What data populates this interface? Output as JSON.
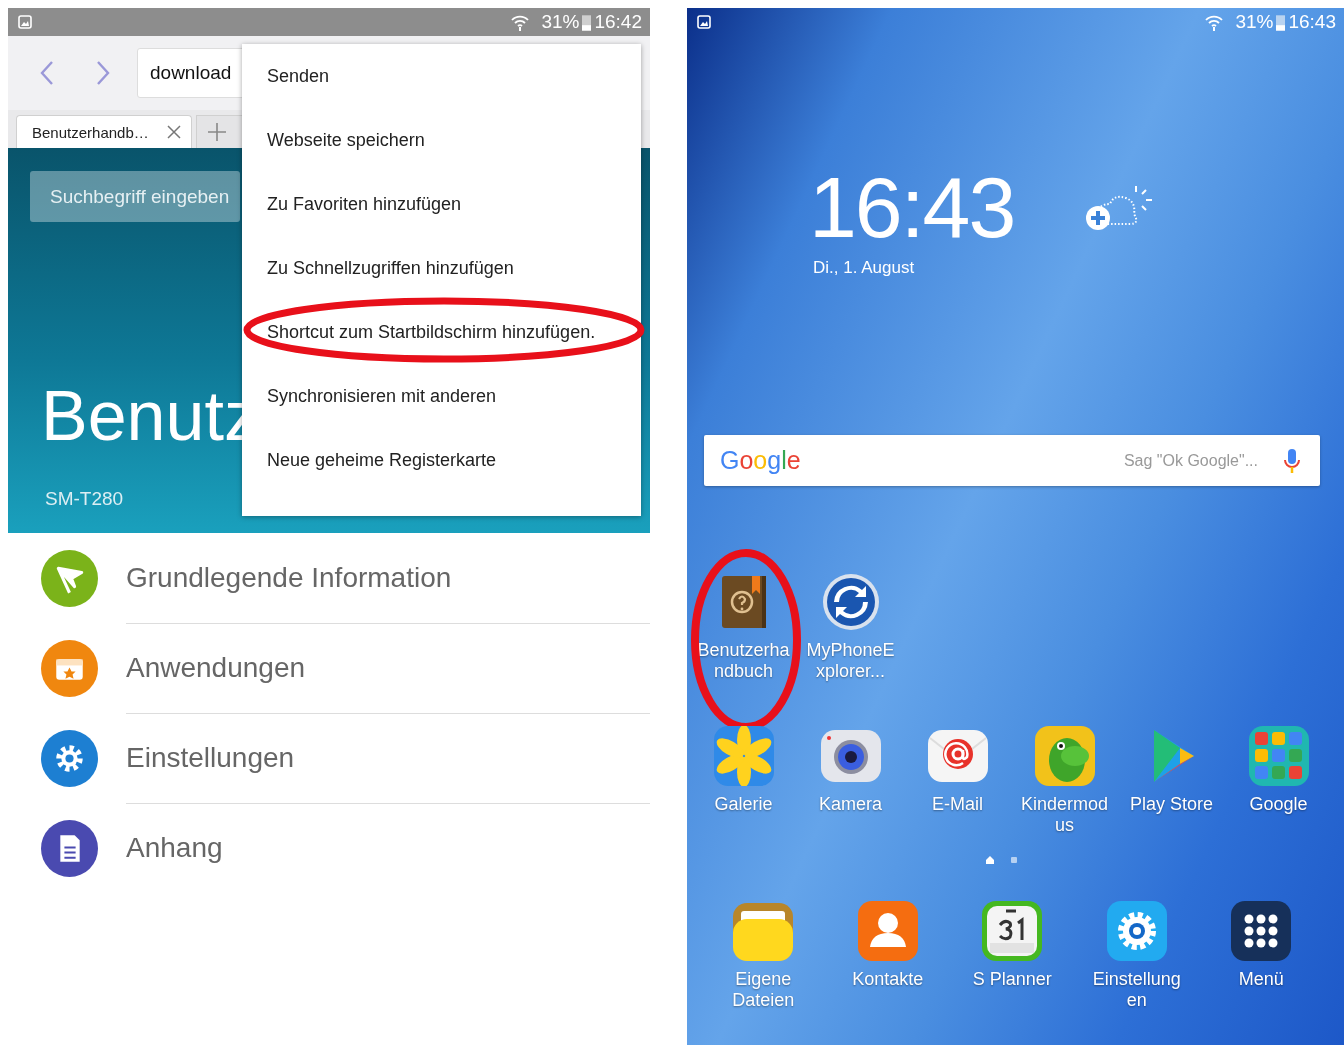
{
  "browser": {
    "status_bar": {
      "battery": "31%",
      "time": "16:42"
    },
    "url": "download",
    "tabs": [
      {
        "label": "Benutzerhandb…",
        "selected": true
      }
    ],
    "header": {
      "search_placeholder": "Suchbegriff eingeben",
      "title": "Benutz",
      "model": "SM-T280"
    },
    "sections": [
      {
        "label": "Grundlegende Information"
      },
      {
        "label": "Anwendungen"
      },
      {
        "label": "Einstellungen"
      },
      {
        "label": "Anhang"
      }
    ],
    "menu": [
      {
        "label": "Senden",
        "highlighted": false
      },
      {
        "label": "Webseite speichern",
        "highlighted": false
      },
      {
        "label": "Zu Favoriten hinzufügen",
        "highlighted": false
      },
      {
        "label": "Zu Schnellzugriffen hinzufügen",
        "highlighted": false
      },
      {
        "label": "Shortcut zum Startbildschirm hinzufügen.",
        "highlighted": true
      },
      {
        "label": "Synchronisieren mit anderen",
        "highlighted": false
      },
      {
        "label": "Neue geheime Registerkarte",
        "highlighted": false
      }
    ]
  },
  "home": {
    "status_bar": {
      "battery": "31%",
      "time": "16:43"
    },
    "clock": {
      "time": "16:43",
      "date": "Di., 1. August"
    },
    "search": {
      "logo": "Google",
      "placeholder": "Sag \"Ok Google\"..."
    },
    "shortcuts": [
      {
        "label": "Benutzerha\nndbuch",
        "highlighted": true
      },
      {
        "label": "MyPhoneE\nxplorer...",
        "highlighted": false
      }
    ],
    "apps": [
      {
        "label": "Galerie"
      },
      {
        "label": "Kamera"
      },
      {
        "label": "E-Mail"
      },
      {
        "label": "Kindermod\nus"
      },
      {
        "label": "Play Store"
      },
      {
        "label": "Google"
      }
    ],
    "pages": [
      {
        "kind": "home",
        "selected": true
      },
      {
        "kind": "page",
        "selected": false
      }
    ],
    "dock": [
      {
        "label": "Eigene\nDateien"
      },
      {
        "label": "Kontakte"
      },
      {
        "label": "S Planner"
      },
      {
        "label": "Einstellung\nen"
      },
      {
        "label": "Menü"
      }
    ]
  }
}
